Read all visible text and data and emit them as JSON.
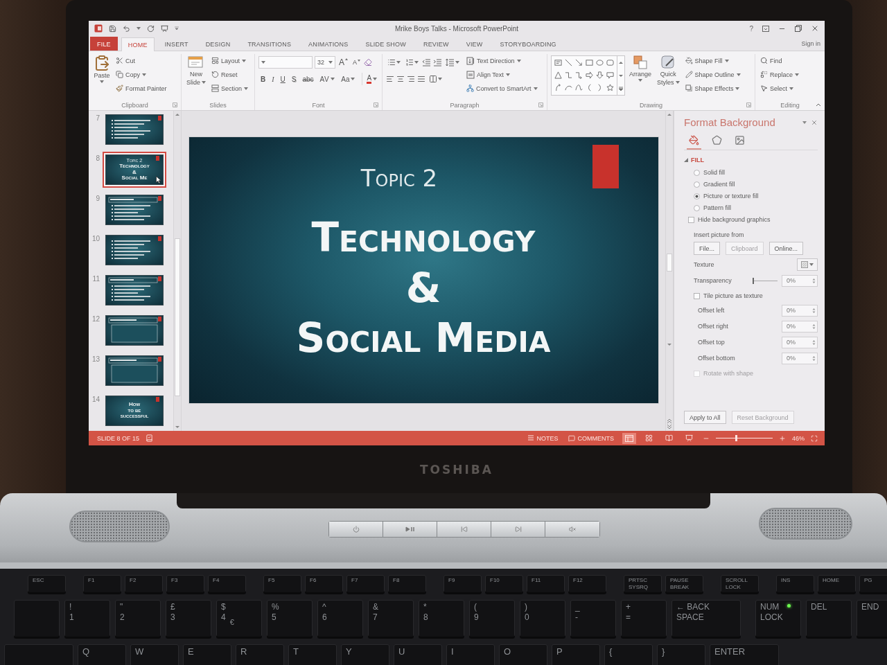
{
  "window": {
    "title": "Mrike Boys Talks - Microsoft PowerPoint",
    "help": "?"
  },
  "tabs": [
    {
      "label": "FILE",
      "kind": "file",
      "selected": false
    },
    {
      "label": "HOME",
      "kind": "tab",
      "selected": true
    },
    {
      "label": "INSERT",
      "kind": "tab",
      "selected": false
    },
    {
      "label": "DESIGN",
      "kind": "tab",
      "selected": false
    },
    {
      "label": "TRANSITIONS",
      "kind": "tab",
      "selected": false
    },
    {
      "label": "ANIMATIONS",
      "kind": "tab",
      "selected": false
    },
    {
      "label": "SLIDE SHOW",
      "kind": "tab",
      "selected": false
    },
    {
      "label": "REVIEW",
      "kind": "tab",
      "selected": false
    },
    {
      "label": "VIEW",
      "kind": "tab",
      "selected": false
    },
    {
      "label": "STORYBOARDING",
      "kind": "tab",
      "selected": false
    }
  ],
  "account": "Sign in",
  "ribbon": {
    "clipboard": {
      "title": "Clipboard",
      "paste": "Paste",
      "items": [
        {
          "label": "Cut",
          "dropdown": false
        },
        {
          "label": "Copy",
          "dropdown": true
        },
        {
          "label": "Format Painter",
          "dropdown": false
        }
      ]
    },
    "slides": {
      "title": "Slides",
      "new_slide": [
        "New",
        "Slide"
      ],
      "items": [
        {
          "label": "Layout",
          "dropdown": true
        },
        {
          "label": "Reset",
          "dropdown": false
        },
        {
          "label": "Section",
          "dropdown": true
        }
      ]
    },
    "font": {
      "title": "Font",
      "font_size": "32",
      "grow": "A",
      "shrink": "A",
      "styles": [
        {
          "label": "B",
          "kind": "bold",
          "dropdown": false
        },
        {
          "label": "I",
          "kind": "italic",
          "dropdown": false
        },
        {
          "label": "U",
          "kind": "underline",
          "dropdown": false
        },
        {
          "label": "S",
          "kind": "shadow",
          "dropdown": false
        },
        {
          "label": "abc",
          "kind": "strike",
          "dropdown": false
        },
        {
          "label": "AV",
          "kind": "spacing",
          "dropdown": true
        },
        {
          "label": "Aa",
          "kind": "case",
          "dropdown": true
        },
        {
          "label": "A",
          "kind": "color",
          "dropdown": true
        }
      ]
    },
    "paragraph": {
      "title": "Paragraph",
      "items": [
        {
          "label": "Text Direction",
          "dropdown": true
        },
        {
          "label": "Align Text",
          "dropdown": true
        },
        {
          "label": "Convert to SmartArt",
          "dropdown": true
        }
      ]
    },
    "drawing": {
      "title": "Drawing",
      "arrange": "Arrange",
      "quick_styles": [
        "Quick",
        "Styles"
      ],
      "items": [
        {
          "label": "Shape Fill",
          "dropdown": true
        },
        {
          "label": "Shape Outline",
          "dropdown": true
        },
        {
          "label": "Shape Effects",
          "dropdown": true
        }
      ]
    },
    "editing": {
      "title": "Editing",
      "items": [
        {
          "label": "Find",
          "dropdown": false
        },
        {
          "label": "Replace",
          "dropdown": true
        },
        {
          "label": "Select",
          "dropdown": true
        }
      ]
    }
  },
  "thumbnails": [
    {
      "number": "7",
      "kind": "bullets",
      "selected": false,
      "pointer": false
    },
    {
      "number": "8",
      "kind": "title",
      "selected": true,
      "pointer": true,
      "subtitle": "Topic 2",
      "lines": [
        "Technology",
        "&",
        "Social Me"
      ]
    },
    {
      "number": "9",
      "kind": "titled_bullets",
      "selected": false,
      "pointer": false
    },
    {
      "number": "10",
      "kind": "bullets",
      "selected": false,
      "pointer": false
    },
    {
      "number": "11",
      "kind": "titled_bullets",
      "selected": false,
      "pointer": false
    },
    {
      "number": "12",
      "kind": "titled_box",
      "selected": false,
      "pointer": false
    },
    {
      "number": "13",
      "kind": "titled_box",
      "selected": false,
      "pointer": false
    },
    {
      "number": "14",
      "kind": "title",
      "selected": false,
      "pointer": false,
      "lines": [
        "How",
        "to be",
        "successful"
      ]
    }
  ],
  "slide": {
    "subtitle": "Topic 2",
    "title_lines": [
      "Technology",
      "&",
      "Social Media"
    ]
  },
  "format_pane": {
    "title": "Format Background",
    "tabs": [
      {
        "kind": "fill",
        "selected": true
      },
      {
        "kind": "effects",
        "selected": false
      },
      {
        "kind": "picture",
        "selected": false
      }
    ],
    "section": {
      "label": "FILL",
      "expanded": true
    },
    "fill_options": [
      {
        "label": "Solid fill",
        "selected": false
      },
      {
        "label": "Gradient fill",
        "selected": false
      },
      {
        "label": "Picture or texture fill",
        "selected": true
      },
      {
        "label": "Pattern fill",
        "selected": false
      }
    ],
    "hide_graphics": {
      "label": "Hide background graphics",
      "checked": false
    },
    "insert_from": {
      "label": "Insert picture from",
      "buttons": [
        {
          "label": "File...",
          "disabled": false
        },
        {
          "label": "Clipboard",
          "disabled": true
        },
        {
          "label": "Online...",
          "disabled": false
        }
      ]
    },
    "texture": {
      "label": "Texture"
    },
    "transparency": {
      "label": "Transparency",
      "level": 0,
      "value": "0%"
    },
    "tile": {
      "label": "Tile picture as texture",
      "checked": false
    },
    "offsets": [
      {
        "label": "Offset left",
        "value": "0%"
      },
      {
        "label": "Offset right",
        "value": "0%"
      },
      {
        "label": "Offset top",
        "value": "0%"
      },
      {
        "label": "Offset bottom",
        "value": "0%"
      }
    ],
    "rotate": {
      "label": "Rotate with shape",
      "checked": false,
      "disabled": true
    },
    "buttons": [
      {
        "label": "Apply to All",
        "disabled": false
      },
      {
        "label": "Reset Background",
        "disabled": true
      }
    ]
  },
  "status_bar": {
    "slide": "SLIDE 8 OF 15",
    "notes": "NOTES",
    "comments": "COMMENTS",
    "views": [
      {
        "kind": "normal",
        "selected": true
      },
      {
        "kind": "sorter",
        "selected": false
      },
      {
        "kind": "reading",
        "selected": false
      },
      {
        "kind": "slideshow",
        "selected": false
      }
    ],
    "zoom": {
      "level": 0.35,
      "value": "46%"
    }
  },
  "laptop": {
    "brand": "TOSHIBA"
  },
  "keyboard": {
    "function_row": [
      {
        "keys": [
          {
            "kind": "standard",
            "labels": [
              "ESC"
            ]
          }
        ]
      },
      {
        "keys": [
          {
            "kind": "standard",
            "labels": [
              "F1"
            ]
          },
          {
            "kind": "standard",
            "labels": [
              "F2"
            ]
          },
          {
            "kind": "standard",
            "labels": [
              "F3"
            ]
          },
          {
            "kind": "standard",
            "labels": [
              "F4"
            ]
          }
        ]
      },
      {
        "keys": [
          {
            "kind": "standard",
            "labels": [
              "F5"
            ]
          },
          {
            "kind": "standard",
            "labels": [
              "F6"
            ]
          },
          {
            "kind": "standard",
            "labels": [
              "F7"
            ]
          },
          {
            "kind": "standard",
            "labels": [
              "F8"
            ]
          }
        ]
      },
      {
        "keys": [
          {
            "kind": "standard",
            "labels": [
              "F9"
            ]
          },
          {
            "kind": "standard",
            "labels": [
              "F10"
            ]
          },
          {
            "kind": "standard",
            "labels": [
              "F11"
            ]
          },
          {
            "kind": "standard",
            "labels": [
              "F12"
            ]
          }
        ]
      },
      {
        "keys": [
          {
            "kind": "standard",
            "labels": [
              "PRTSC",
              "SYSRQ"
            ]
          },
          {
            "kind": "standard",
            "labels": [
              "PAUSE",
              "BREAK"
            ]
          }
        ]
      },
      {
        "keys": [
          {
            "kind": "standard",
            "labels": [
              "SCROLL",
              "LOCK"
            ]
          }
        ]
      },
      {
        "keys": [
          {
            "kind": "standard",
            "labels": [
              "INS"
            ]
          },
          {
            "kind": "standard",
            "labels": [
              "HOME"
            ]
          },
          {
            "kind": "standard",
            "labels": [
              "PG"
            ]
          }
        ]
      }
    ],
    "number_row": [
      {
        "keys": [
          {
            "kind": "standard"
          },
          {
            "kind": "standard",
            "labels": [
              "!",
              "1"
            ]
          },
          {
            "kind": "standard",
            "labels": [
              "\"",
              "2"
            ]
          },
          {
            "kind": "standard",
            "labels": [
              "£",
              "3"
            ]
          },
          {
            "kind": "standard",
            "labels": [
              "$",
              "4"
            ],
            "extra": "€"
          },
          {
            "kind": "standard",
            "labels": [
              "%",
              "5"
            ]
          },
          {
            "kind": "standard",
            "labels": [
              "^",
              "6"
            ]
          },
          {
            "kind": "standard",
            "labels": [
              "&",
              "7"
            ]
          },
          {
            "kind": "standard",
            "labels": [
              "*",
              "8"
            ]
          },
          {
            "kind": "standard",
            "labels": [
              "(",
              "9"
            ]
          },
          {
            "kind": "standard",
            "labels": [
              ")",
              "0"
            ]
          },
          {
            "kind": "standard",
            "labels": [
              "_",
              "-"
            ]
          },
          {
            "kind": "standard",
            "labels": [
              "+",
              "="
            ]
          },
          {
            "kind": "wide",
            "labels": [
              "← BACK",
              "SPACE"
            ]
          }
        ]
      },
      {
        "keys": [
          {
            "kind": "standard",
            "labels": [
              "NUM",
              "LOCK"
            ],
            "light": true
          },
          {
            "kind": "standard",
            "labels": [
              "DEL"
            ]
          },
          {
            "kind": "standard",
            "labels": [
              "END"
            ]
          }
        ]
      }
    ],
    "letter_row": [
      {
        "keys": [
          {
            "kind": "wide"
          },
          {
            "kind": "standard",
            "labels": [
              "Q"
            ]
          },
          {
            "kind": "standard",
            "labels": [
              "W"
            ]
          },
          {
            "kind": "standard",
            "labels": [
              "E"
            ]
          },
          {
            "kind": "standard",
            "labels": [
              "R"
            ]
          },
          {
            "kind": "standard",
            "labels": [
              "T"
            ]
          },
          {
            "kind": "standard",
            "labels": [
              "Y"
            ]
          },
          {
            "kind": "standard",
            "labels": [
              "U"
            ]
          },
          {
            "kind": "standard",
            "labels": [
              "I"
            ]
          },
          {
            "kind": "standard",
            "labels": [
              "O"
            ]
          },
          {
            "kind": "standard",
            "labels": [
              "P"
            ]
          },
          {
            "kind": "standard",
            "labels": [
              "{"
            ]
          },
          {
            "kind": "standard",
            "labels": [
              "}"
            ]
          },
          {
            "kind": "wide",
            "labels": [
              "ENTER"
            ]
          }
        ]
      }
    ]
  }
}
